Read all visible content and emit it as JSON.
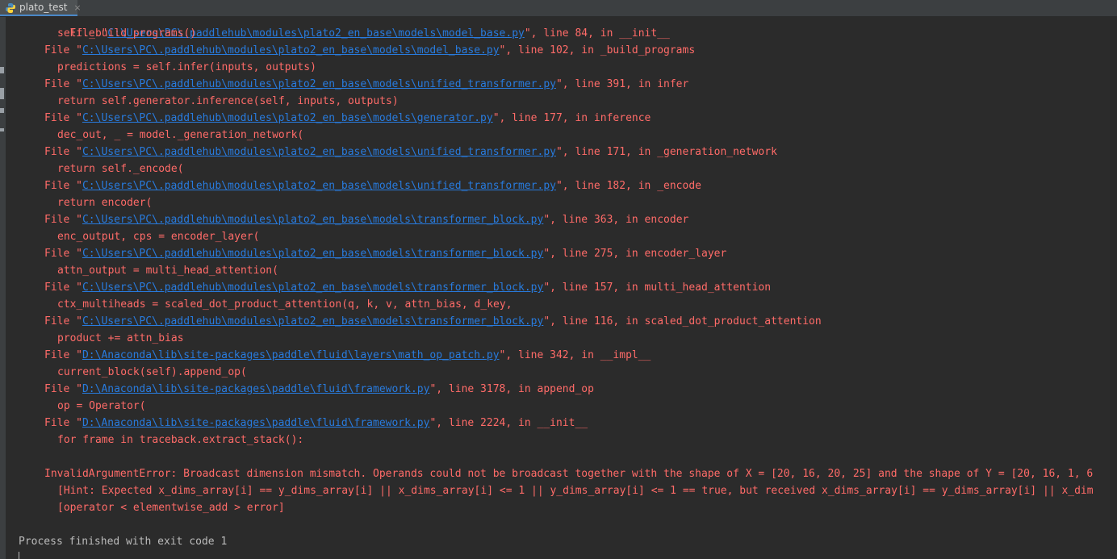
{
  "tab": {
    "label": "plato_test",
    "close": "×",
    "icon": "python-icon"
  },
  "trace": [
    {
      "kind": "code",
      "text": "self._build_programs()"
    },
    {
      "kind": "file",
      "pre": "File \"",
      "link": "C:\\Users\\PC\\.paddlehub\\modules\\plato2_en_base\\models\\model_base.py",
      "post": "\", line 102, in _build_programs"
    },
    {
      "kind": "code",
      "text": "predictions = self.infer(inputs, outputs)"
    },
    {
      "kind": "file",
      "pre": "File \"",
      "link": "C:\\Users\\PC\\.paddlehub\\modules\\plato2_en_base\\models\\unified_transformer.py",
      "post": "\", line 391, in infer"
    },
    {
      "kind": "code",
      "text": "return self.generator.inference(self, inputs, outputs)"
    },
    {
      "kind": "file",
      "pre": "File \"",
      "link": "C:\\Users\\PC\\.paddlehub\\modules\\plato2_en_base\\models\\generator.py",
      "post": "\", line 177, in inference"
    },
    {
      "kind": "code",
      "text": "dec_out, _ = model._generation_network("
    },
    {
      "kind": "file",
      "pre": "File \"",
      "link": "C:\\Users\\PC\\.paddlehub\\modules\\plato2_en_base\\models\\unified_transformer.py",
      "post": "\", line 171, in _generation_network"
    },
    {
      "kind": "code",
      "text": "return self._encode("
    },
    {
      "kind": "file",
      "pre": "File \"",
      "link": "C:\\Users\\PC\\.paddlehub\\modules\\plato2_en_base\\models\\unified_transformer.py",
      "post": "\", line 182, in _encode"
    },
    {
      "kind": "code",
      "text": "return encoder("
    },
    {
      "kind": "file",
      "pre": "File \"",
      "link": "C:\\Users\\PC\\.paddlehub\\modules\\plato2_en_base\\models\\transformer_block.py",
      "post": "\", line 363, in encoder"
    },
    {
      "kind": "code",
      "text": "enc_output, cps = encoder_layer("
    },
    {
      "kind": "file",
      "pre": "File \"",
      "link": "C:\\Users\\PC\\.paddlehub\\modules\\plato2_en_base\\models\\transformer_block.py",
      "post": "\", line 275, in encoder_layer"
    },
    {
      "kind": "code",
      "text": "attn_output = multi_head_attention("
    },
    {
      "kind": "file",
      "pre": "File \"",
      "link": "C:\\Users\\PC\\.paddlehub\\modules\\plato2_en_base\\models\\transformer_block.py",
      "post": "\", line 157, in multi_head_attention"
    },
    {
      "kind": "code",
      "text": "ctx_multiheads = scaled_dot_product_attention(q, k, v, attn_bias, d_key,"
    },
    {
      "kind": "file",
      "pre": "File \"",
      "link": "C:\\Users\\PC\\.paddlehub\\modules\\plato2_en_base\\models\\transformer_block.py",
      "post": "\", line 116, in scaled_dot_product_attention"
    },
    {
      "kind": "code",
      "text": "product += attn_bias"
    },
    {
      "kind": "file",
      "pre": "File \"",
      "link": "D:\\Anaconda\\lib\\site-packages\\paddle\\fluid\\layers\\math_op_patch.py",
      "post": "\", line 342, in __impl__"
    },
    {
      "kind": "code",
      "text": "current_block(self).append_op("
    },
    {
      "kind": "file",
      "pre": "File \"",
      "link": "D:\\Anaconda\\lib\\site-packages\\paddle\\fluid\\framework.py",
      "post": "\", line 3178, in append_op"
    },
    {
      "kind": "code",
      "text": "op = Operator("
    },
    {
      "kind": "file",
      "pre": "File \"",
      "link": "D:\\Anaconda\\lib\\site-packages\\paddle\\fluid\\framework.py",
      "post": "\", line 2224, in __init__"
    },
    {
      "kind": "code",
      "text": "for frame in traceback.extract_stack():"
    }
  ],
  "top_partial": {
    "pre": "File \"",
    "link": "C:\\Users\\PC\\.paddlehub\\modules\\plato2_en_base\\models\\model_base.py",
    "post": "\", line 84, in __init__"
  },
  "error": {
    "message": "InvalidArgumentError: Broadcast dimension mismatch. Operands could not be broadcast together with the shape of X = [20, 16, 20, 25] and the shape of Y = [20, 16, 1, 6",
    "hint": "[Hint: Expected x_dims_array[i] == y_dims_array[i] || x_dims_array[i] <= 1 || y_dims_array[i] <= 1 == true, but received x_dims_array[i] == y_dims_array[i] || x_dim",
    "operator": "[operator < elementwise_add > error]"
  },
  "process": "Process finished with exit code 1"
}
